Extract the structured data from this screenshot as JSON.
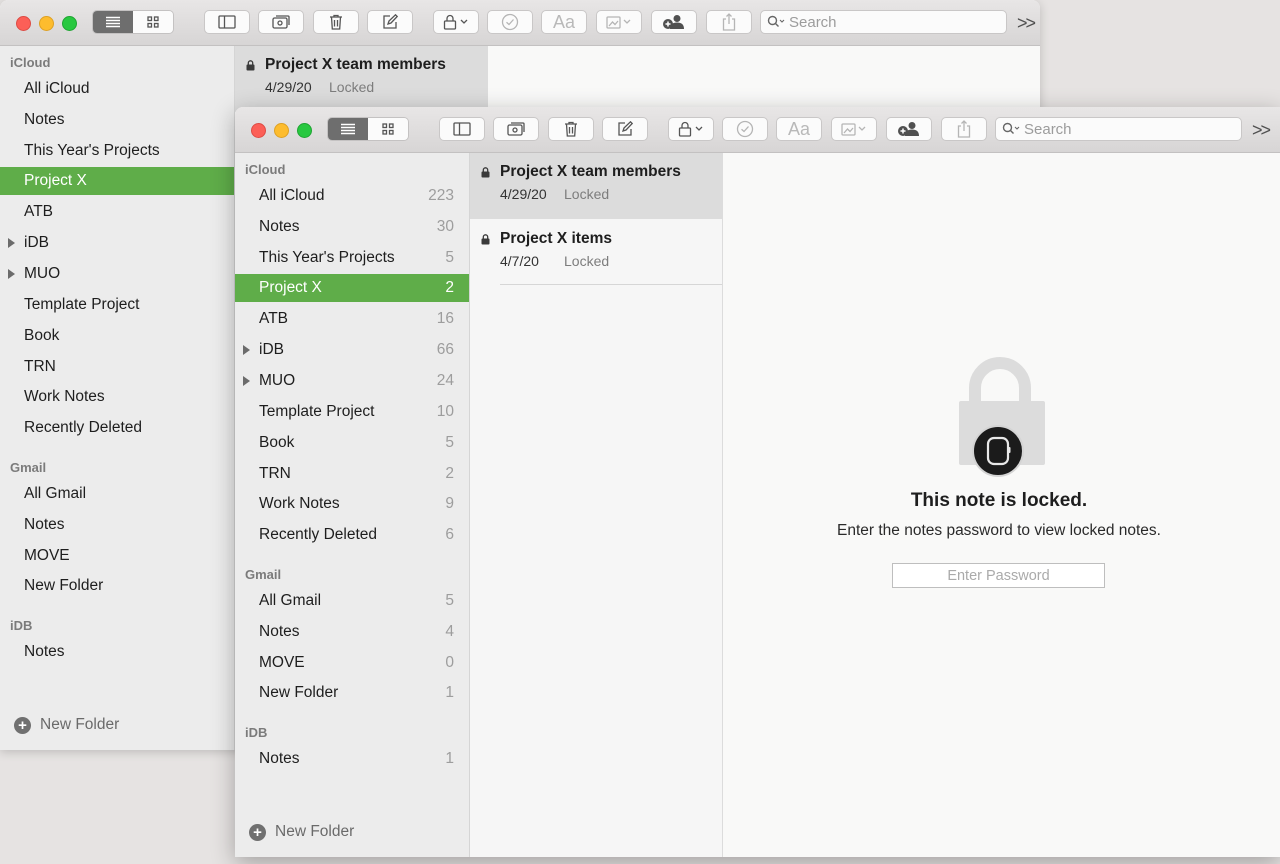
{
  "toolbar": {
    "search_placeholder": "Search"
  },
  "sidebar": {
    "sections": [
      {
        "title": "iCloud",
        "folders": [
          {
            "label": "All iCloud",
            "count": "223"
          },
          {
            "label": "Notes",
            "count": "30"
          },
          {
            "label": "This Year's Projects",
            "count": "5"
          },
          {
            "label": "Project X",
            "count": "2",
            "selected": true
          },
          {
            "label": "ATB",
            "count": "16"
          },
          {
            "label": "iDB",
            "count": "66",
            "expandable": true
          },
          {
            "label": "MUO",
            "count": "24",
            "expandable": true
          },
          {
            "label": "Template Project",
            "count": "10"
          },
          {
            "label": "Book",
            "count": "5"
          },
          {
            "label": "TRN",
            "count": "2"
          },
          {
            "label": "Work Notes",
            "count": "9"
          },
          {
            "label": "Recently Deleted",
            "count": "6"
          }
        ]
      },
      {
        "title": "Gmail",
        "folders": [
          {
            "label": "All Gmail",
            "count": "5"
          },
          {
            "label": "Notes",
            "count": "4"
          },
          {
            "label": "MOVE",
            "count": "0"
          },
          {
            "label": "New Folder",
            "count": "1"
          }
        ]
      },
      {
        "title": "iDB",
        "folders": [
          {
            "label": "Notes",
            "count": "1"
          }
        ]
      }
    ],
    "new_folder_label": "New Folder"
  },
  "notes": [
    {
      "title": "Project X team members",
      "date": "4/29/20",
      "status": "Locked",
      "selected": true
    },
    {
      "title": "Project X items",
      "date": "4/7/20",
      "status": "Locked"
    }
  ],
  "locked_view": {
    "title": "This note is locked.",
    "message": "Enter the notes password to view locked notes.",
    "password_placeholder": "Enter Password"
  },
  "colors": {
    "accent_selection": "#5fad49",
    "traffic_close": "#fc5f57",
    "traffic_minimize": "#fdbc2e",
    "traffic_zoom": "#28c840"
  }
}
